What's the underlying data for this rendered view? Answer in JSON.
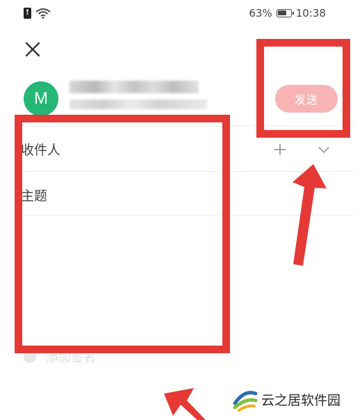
{
  "status_bar": {
    "battery": "63%",
    "time": "10:38"
  },
  "header": {
    "avatar_letter": "M",
    "send_label": "发送"
  },
  "form": {
    "recipient_label": "收件人",
    "subject_label": "主题",
    "attachment_label": "添加签名"
  },
  "watermark": {
    "text": "云之居软件园"
  },
  "colors": {
    "annotation": "#e53935",
    "send_button": "#f8b4b4",
    "avatar": "#25b776"
  }
}
